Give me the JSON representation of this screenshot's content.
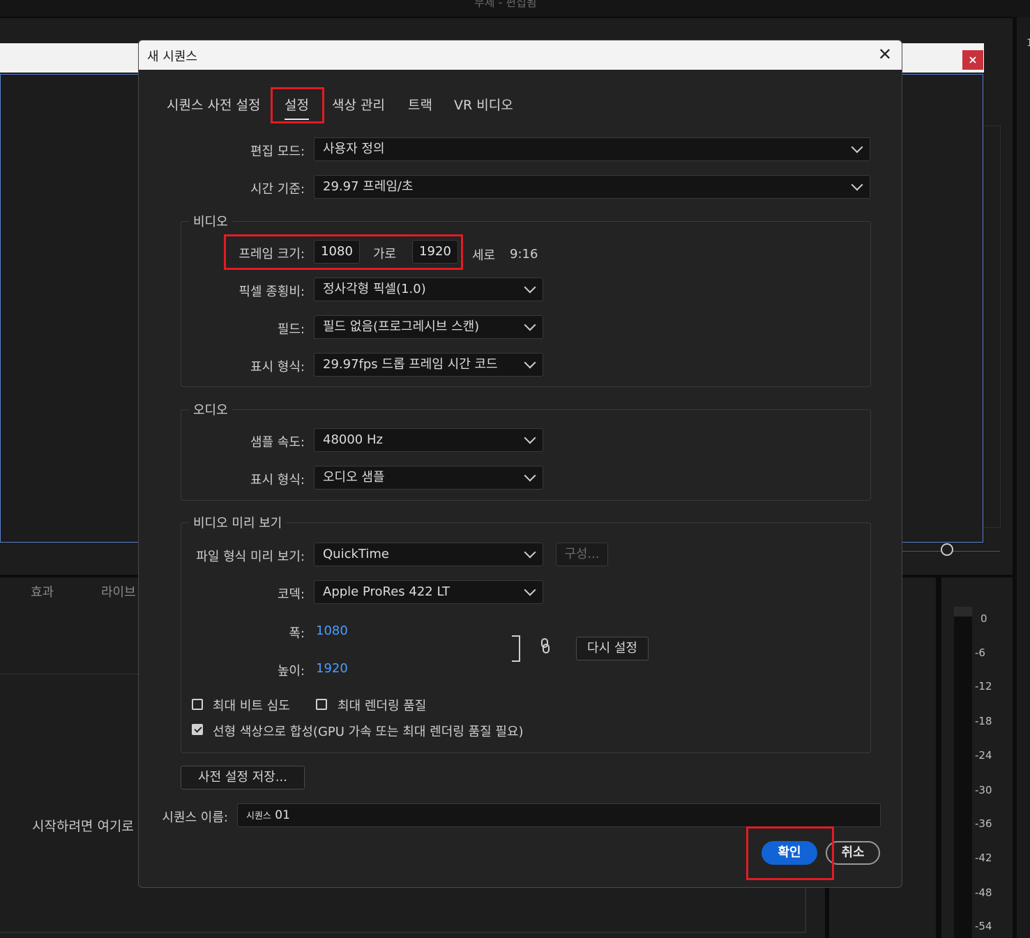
{
  "background": {
    "window_title": "무제 - 편집됨",
    "tabs": [
      "효과",
      "라이브"
    ],
    "start_hint": "시작하려면 여기로",
    "close_glyph": "×",
    "meter_labels": [
      "0",
      "-6",
      "-12",
      "-18",
      "-24",
      "-30",
      "-36",
      "-42",
      "-48",
      "-54"
    ],
    "right_mark": "1"
  },
  "dialog": {
    "title": "새 시퀀스",
    "close_glyph": "✕",
    "tabs": [
      {
        "label": "시퀀스 사전 설정",
        "active": false
      },
      {
        "label": "설정",
        "active": true
      },
      {
        "label": "색상 관리",
        "active": false
      },
      {
        "label": "트랙",
        "active": false
      },
      {
        "label": "VR 비디오",
        "active": false
      }
    ],
    "editing_mode": {
      "label": "편집 모드:",
      "value": "사용자 정의"
    },
    "timebase": {
      "label": "시간 기준:",
      "value": "29.97  프레임/초"
    },
    "video": {
      "title": "비디오",
      "frame_size": {
        "label": "프레임 크기:",
        "width": "1080",
        "width_label": "가로",
        "height": "1920",
        "height_label": "세로",
        "aspect": "9:16"
      },
      "pixel_aspect": {
        "label": "픽셀 종횡비:",
        "value": "정사각형 픽셀(1.0)"
      },
      "fields": {
        "label": "필드:",
        "value": "필드 없음(프로그레시브 스캔)"
      },
      "display_format": {
        "label": "표시 형식:",
        "value": "29.97fps 드롭 프레임 시간 코드"
      }
    },
    "audio": {
      "title": "오디오",
      "sample_rate": {
        "label": "샘플 속도:",
        "value": "48000 Hz"
      },
      "display_format": {
        "label": "표시 형식:",
        "value": "오디오 샘플"
      }
    },
    "preview": {
      "title": "비디오 미리 보기",
      "file_format": {
        "label": "파일 형식 미리 보기:",
        "value": "QuickTime",
        "configure_label": "구성..."
      },
      "codec": {
        "label": "코덱:",
        "value": "Apple ProRes 422 LT"
      },
      "width": {
        "label": "폭:",
        "value": "1080"
      },
      "height": {
        "label": "높이:",
        "value": "1920"
      },
      "reset_label": "다시 설정",
      "link_glyph": "🔗",
      "max_bit_depth": {
        "label": "최대 비트 심도",
        "checked": false
      },
      "max_render_quality": {
        "label": "최대 렌더링 품질",
        "checked": false
      },
      "linear_color": {
        "label": "선형 색상으로 합성(GPU 가속 또는 최대 렌더링 품질 필요)",
        "checked": true
      }
    },
    "save_preset_label": "사전 설정 저장...",
    "sequence_name": {
      "label": "시퀀스 이름:",
      "value_prefix": "시퀀스",
      "value_suffix": " 01"
    },
    "ok_label": "확인",
    "cancel_label": "취소"
  },
  "colors": {
    "accent": "#1163d6",
    "highlight": "#e31b23",
    "link_value": "#4a9eff"
  }
}
